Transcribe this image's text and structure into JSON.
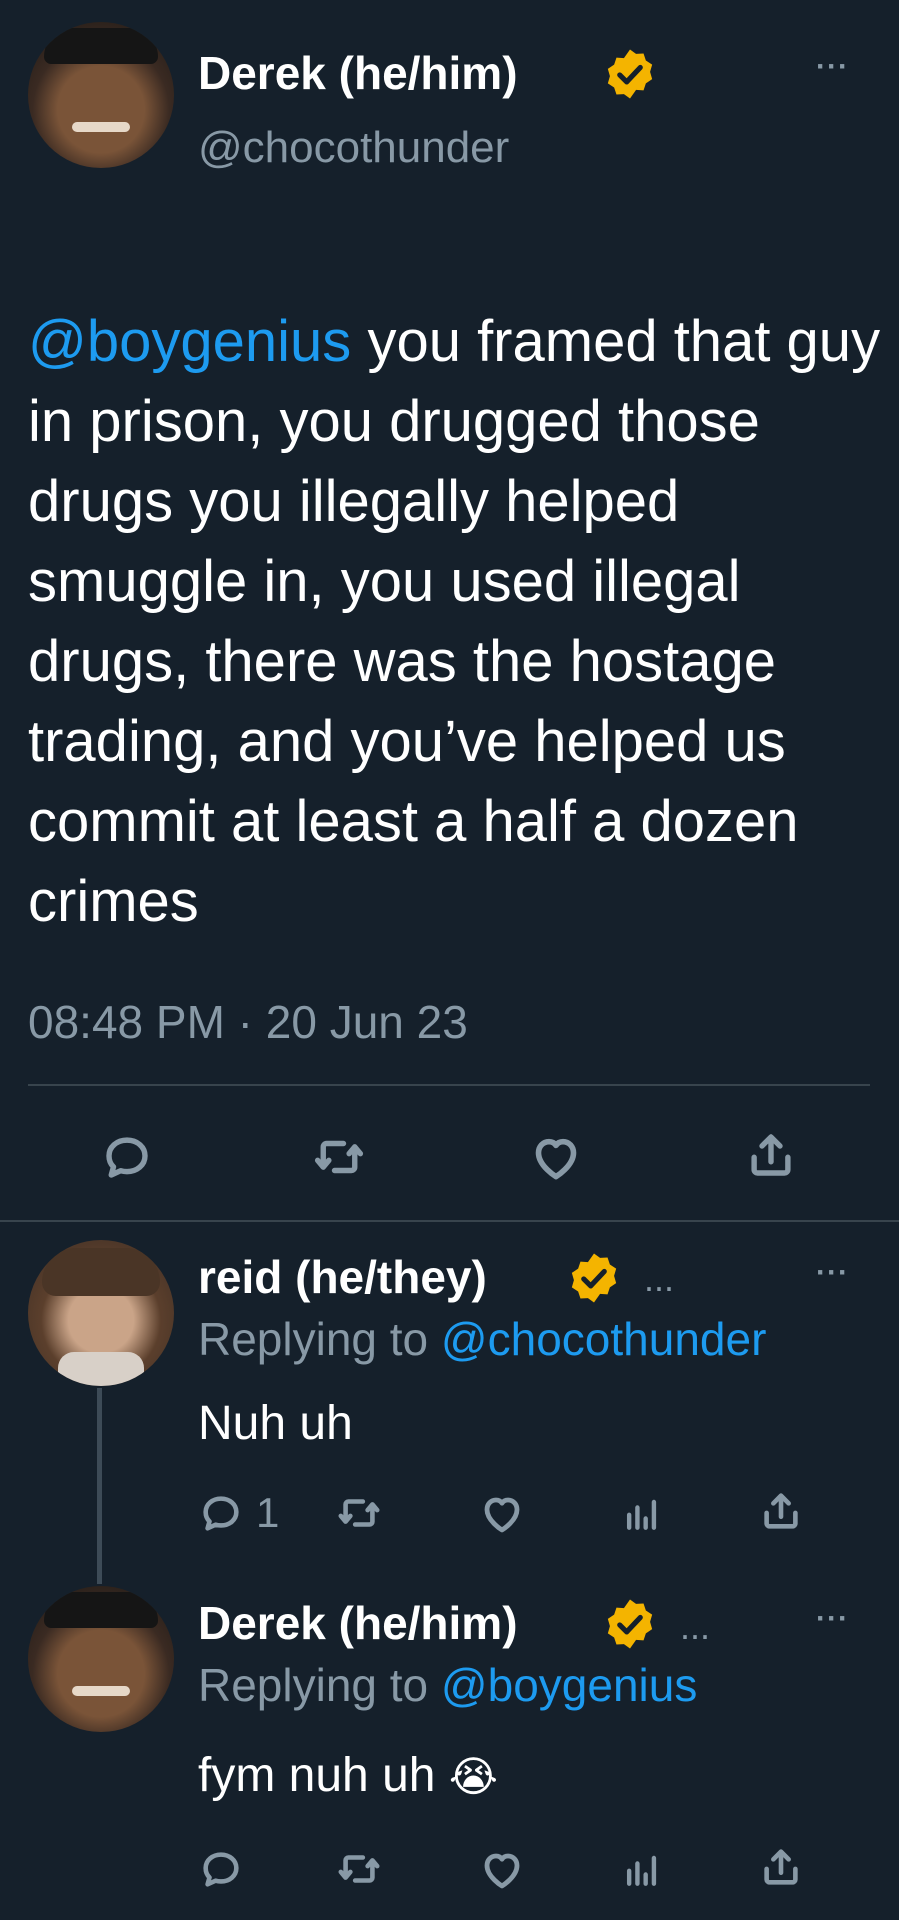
{
  "main_tweet": {
    "author_name": "Derek (he/him)",
    "handle": "@chocothunder",
    "mention": "@boygenius",
    "text": "you framed that guy in prison, you drugged those drugs you illegally helped smuggle in, you used illegal drugs, there was the hostage trading, and you’ve helped us commit at least a half a dozen crimes",
    "time": "08:48 PM · 20 Jun 23",
    "more": "···"
  },
  "reply1": {
    "author_name": "reid (he/they)",
    "replying_prefix": "Replying to ",
    "replying_to": "@chocothunder",
    "text": "Nuh uh",
    "reply_count": "1",
    "truncation": "...",
    "more": "···"
  },
  "reply2": {
    "author_name": "Derek (he/him)",
    "replying_prefix": "Replying to ",
    "replying_to": "@boygenius",
    "text": "fym nuh uh",
    "emoji": "😭",
    "truncation": "...",
    "more": "···"
  },
  "colors": {
    "background": "#15202b",
    "accent": "#1d9bf0",
    "muted": "#8899a6",
    "badge": "#f4b400"
  },
  "icons": [
    "reply-icon",
    "retweet-icon",
    "like-icon",
    "share-icon",
    "analytics-icon",
    "verified-badge-icon",
    "more-icon",
    "crying-emoji-icon"
  ]
}
